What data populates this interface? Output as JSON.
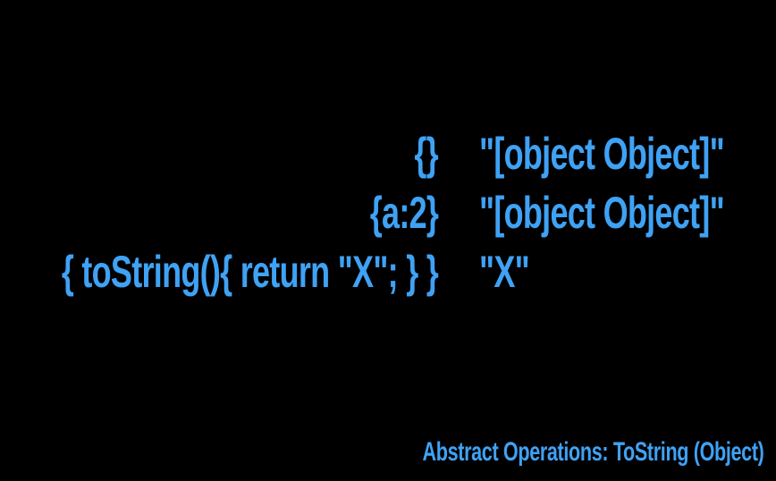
{
  "colors": {
    "background": "#000000",
    "text": "#3fa2f4"
  },
  "rows": [
    {
      "input": "{}",
      "result": "\"[object Object]\""
    },
    {
      "input": "{a:2}",
      "result": "\"[object Object]\""
    },
    {
      "input": "{ toString(){ return \"X\"; } }",
      "result": "\"X\""
    }
  ],
  "footer": {
    "title": "Abstract Operations: ToString (Object)"
  }
}
